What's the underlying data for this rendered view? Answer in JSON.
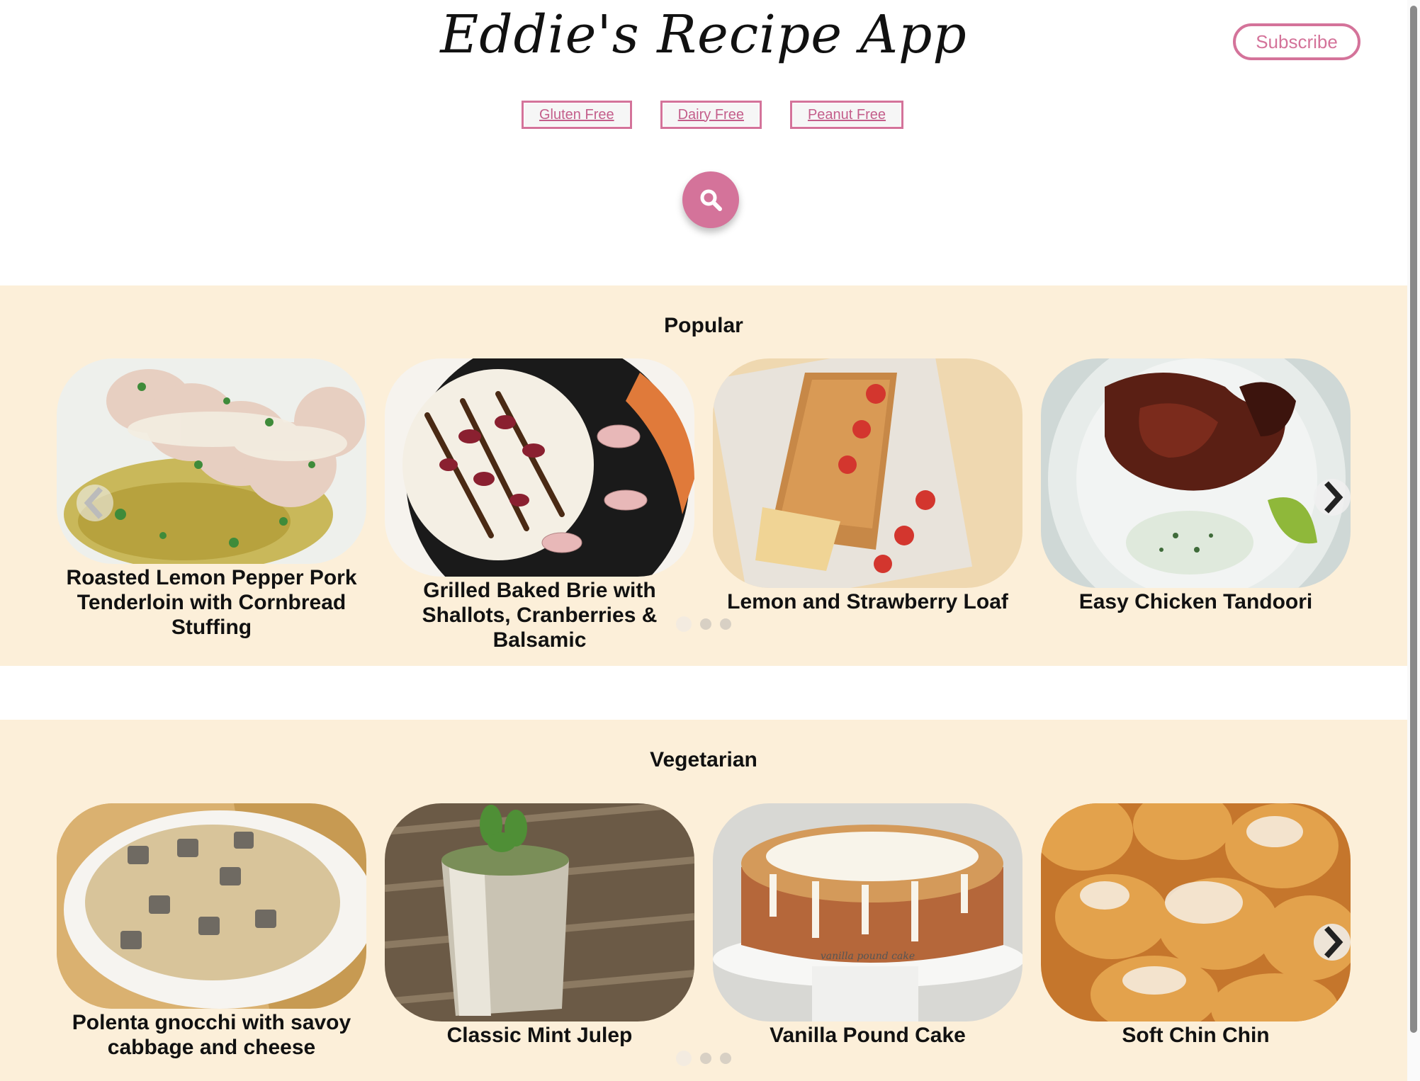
{
  "header": {
    "brand": "Eddie's Recipe App",
    "subscribe_label": "Subscribe",
    "filters": [
      "Gluten Free",
      "Dairy Free",
      "Peanut Free"
    ],
    "search_icon": "search-icon"
  },
  "colors": {
    "accent": "#d4739a",
    "section_bg": "#fcefd9"
  },
  "sections": [
    {
      "title": "Popular",
      "cards": [
        {
          "title": "Roasted Lemon Pepper Pork Tenderloin with Cornbread Stuffing"
        },
        {
          "title": "Grilled Baked Brie with Shallots, Cranberries & Balsamic"
        },
        {
          "title": "Lemon and Strawberry Loaf"
        },
        {
          "title": "Easy Chicken Tandoori"
        }
      ],
      "pagination": {
        "pages": 3,
        "active": 1
      }
    },
    {
      "title": "Vegetarian",
      "cards": [
        {
          "title": "Polenta gnocchi with savoy cabbage and cheese"
        },
        {
          "title": "Classic Mint Julep"
        },
        {
          "title": "Vanilla Pound Cake",
          "image_caption": "vanilla pound cake"
        },
        {
          "title": "Soft Chin Chin"
        }
      ],
      "pagination": {
        "pages": 3,
        "active": 1
      }
    }
  ]
}
